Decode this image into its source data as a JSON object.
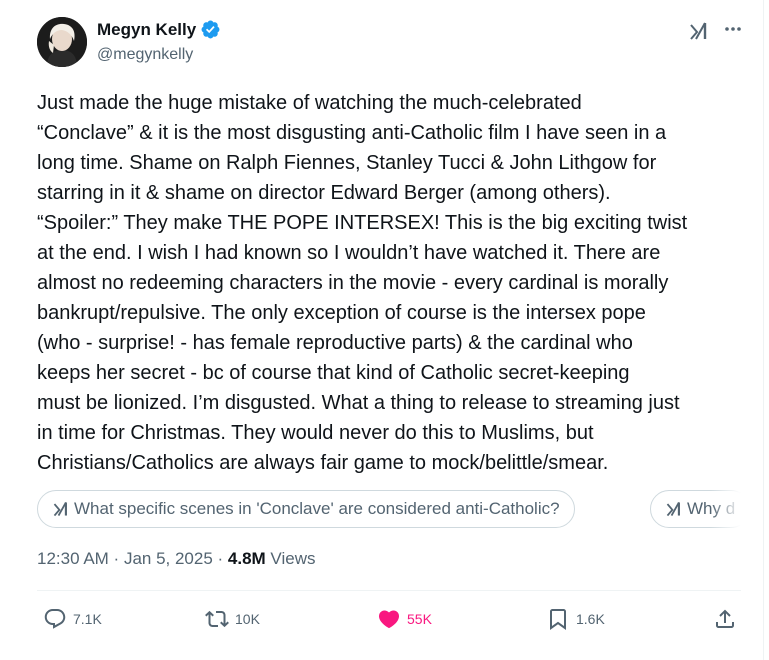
{
  "author": {
    "name": "Megyn Kelly",
    "handle": "@megynkelly"
  },
  "tweet": {
    "text": "Just made the huge mistake of watching the much-celebrated\n“Conclave” & it is the most disgusting anti-Catholic film I have seen in a\nlong time. Shame on Ralph Fiennes, Stanley Tucci & John Lithgow for\nstarring in it & shame on director Edward Berger (among others).\n“Spoiler:” They make THE POPE INTERSEX! This is the big exciting twist\nat the end. I wish I had known so I wouldn’t have watched it. There are\nalmost no redeeming characters in the movie - every cardinal is morally\nbankrupt/repulsive. The only exception of course is the intersex pope\n(who - surprise! - has female reproductive parts) & the cardinal who\nkeeps her secret - bc of course that kind of Catholic secret-keeping\nmust be lionized. I’m disgusted. What a thing to release to streaming just\nin time for Christmas. They would never do this to Muslims, but\nChristians/Catholics are always fair game to mock/belittle/smear."
  },
  "grok_suggestions": [
    "What specific scenes in 'Conclave' are considered anti-Catholic?",
    "Why d"
  ],
  "meta": {
    "time": "12:30 AM",
    "sep1": " · ",
    "date": "Jan 5, 2025",
    "sep2": " · ",
    "views_count": "4.8M",
    "views_label": " Views"
  },
  "actions": {
    "replies": "7.1K",
    "reposts": "10K",
    "likes": "55K",
    "bookmarks": "1.6K"
  },
  "colors": {
    "text": "#0f1419",
    "secondary": "#536471",
    "verified": "#1d9bf0",
    "like": "#f91880"
  },
  "icons": [
    "verified-badge-icon",
    "grok-icon",
    "more-icon",
    "reply-icon",
    "repost-icon",
    "like-icon",
    "bookmark-icon",
    "share-icon"
  ]
}
